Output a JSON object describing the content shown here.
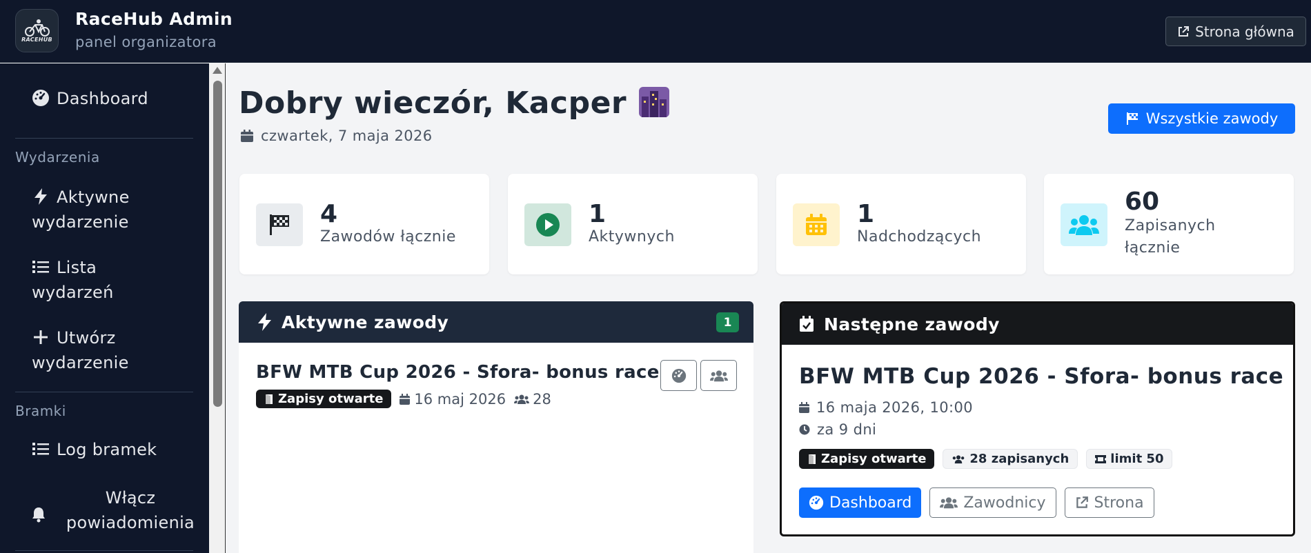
{
  "header": {
    "logo_text": "RACEHUB",
    "title": "RaceHub Admin",
    "subtitle": "panel organizatora",
    "home_button": "Strona główna"
  },
  "sidebar": {
    "dashboard": "Dashboard",
    "section_events": "Wydarzenia",
    "active_event_l1": "Aktywne",
    "active_event_l2": "wydarzenie",
    "list_l1": "Lista",
    "list_l2": "wydarzeń",
    "create_l1": "Utwórz",
    "create_l2": "wydarzenie",
    "section_gates": "Bramki",
    "gate_log": "Log bramek",
    "notify_l1": "Włącz",
    "notify_l2": "powiadomienia"
  },
  "main": {
    "greeting": "Dobry wieczór, Kacper",
    "date": "czwartek, 7 maja 2026",
    "all_events_button": "Wszystkie zawody"
  },
  "stats": [
    {
      "value": "4",
      "label": "Zawodów łącznie",
      "color": "#212529",
      "bg": "#e9ecef"
    },
    {
      "value": "1",
      "label": "Aktywnych",
      "color": "#198754",
      "bg": "#d1e7dd"
    },
    {
      "value": "1",
      "label": "Nadchodzących",
      "color": "#ffc107",
      "bg": "#fff3cd"
    },
    {
      "value": "60",
      "label_l1": "Zapisanych",
      "label_l2": "łącznie",
      "color": "#0dcaf0",
      "bg": "#cff4fc"
    }
  ],
  "active": {
    "header": "Aktywne zawody",
    "count": "1",
    "event_title": "BFW MTB Cup 2026 - Sfora- bonus race",
    "status": "Zapisy otwarte",
    "date": "16 maj 2026",
    "participants": "28"
  },
  "next": {
    "header": "Następne zawody",
    "event_title": "BFW MTB Cup 2026 - Sfora- bonus race",
    "datetime": "16 maja 2026, 10:00",
    "countdown": "za 9 dni",
    "status": "Zapisy otwarte",
    "registered": "28 zapisanych",
    "limit": "limit 50",
    "btn_dashboard": "Dashboard",
    "btn_riders": "Zawodnicy",
    "btn_page": "Strona"
  },
  "colors": {
    "primary": "#0d6efd",
    "dark_nav": "#0f172a",
    "success": "#198754"
  }
}
